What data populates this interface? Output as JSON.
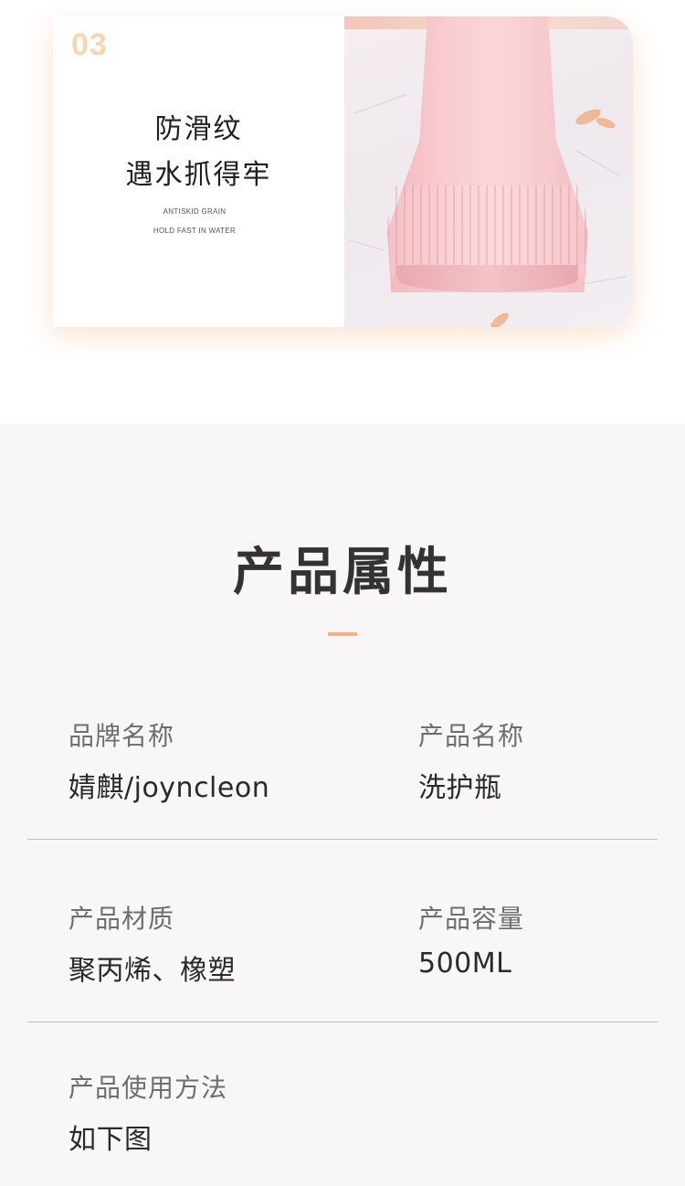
{
  "feature": {
    "number": "03",
    "title_line1": "防滑纹",
    "title_line2": "遇水抓得牢",
    "en_line1": "ANTISKID GRAIN",
    "en_line2": "HOLD FAST IN WATER"
  },
  "attributes": {
    "title": "产品属性",
    "brand_label": "品牌名称",
    "brand_value": "婧麒/joyncleon",
    "name_label": "产品名称",
    "name_value": "洗护瓶",
    "material_label": "产品材质",
    "material_value": "聚丙烯、橡塑",
    "capacity_label": "产品容量",
    "capacity_value": "500ML",
    "usage_label": "产品使用方法",
    "usage_value": "如下图"
  },
  "colors": {
    "accent": "#f7b27a",
    "number": "#f8d3b4",
    "bottle": "#f9cfd3",
    "section_bg": "#f8f7f6"
  }
}
